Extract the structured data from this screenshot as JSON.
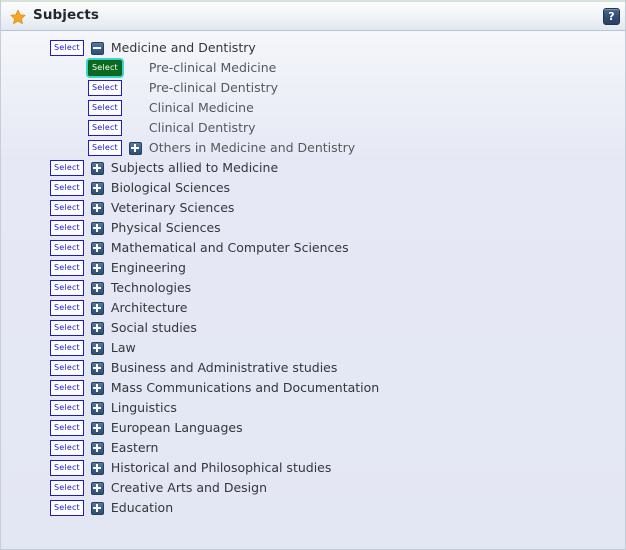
{
  "header": {
    "title": "Subjects",
    "star_icon": "star-icon",
    "help_label": "?",
    "help_icon": "help-question-icon"
  },
  "labels": {
    "select": "Select"
  },
  "colors": {
    "accent_blue": "#2d4f77",
    "select_border": "#1b1bd0",
    "select_text": "#1b1bd0",
    "selected_bg": "#0a6b20",
    "selected_glow": "#3bd4cf",
    "star": "#f2a11f",
    "panel_bg": "#e3e6f3"
  },
  "tree": [
    {
      "label": "Medicine and Dentistry",
      "level": 0,
      "toggle": "minus",
      "selected": false
    },
    {
      "label": "Pre-clinical Medicine",
      "level": 1,
      "toggle": "none",
      "selected": true
    },
    {
      "label": "Pre-clinical Dentistry",
      "level": 1,
      "toggle": "none",
      "selected": false
    },
    {
      "label": "Clinical Medicine",
      "level": 1,
      "toggle": "none",
      "selected": false
    },
    {
      "label": "Clinical Dentistry",
      "level": 1,
      "toggle": "none",
      "selected": false
    },
    {
      "label": "Others in Medicine and Dentistry",
      "level": 1,
      "toggle": "plus",
      "selected": false
    },
    {
      "label": "Subjects allied to Medicine",
      "level": 0,
      "toggle": "plus",
      "selected": false
    },
    {
      "label": "Biological Sciences",
      "level": 0,
      "toggle": "plus",
      "selected": false
    },
    {
      "label": "Veterinary Sciences",
      "level": 0,
      "toggle": "plus",
      "selected": false
    },
    {
      "label": "Physical Sciences",
      "level": 0,
      "toggle": "plus",
      "selected": false
    },
    {
      "label": "Mathematical and Computer Sciences",
      "level": 0,
      "toggle": "plus",
      "selected": false
    },
    {
      "label": "Engineering",
      "level": 0,
      "toggle": "plus",
      "selected": false
    },
    {
      "label": "Technologies",
      "level": 0,
      "toggle": "plus",
      "selected": false
    },
    {
      "label": "Architecture",
      "level": 0,
      "toggle": "plus",
      "selected": false
    },
    {
      "label": "Social studies",
      "level": 0,
      "toggle": "plus",
      "selected": false
    },
    {
      "label": "Law",
      "level": 0,
      "toggle": "plus",
      "selected": false
    },
    {
      "label": "Business and Administrative studies",
      "level": 0,
      "toggle": "plus",
      "selected": false
    },
    {
      "label": "Mass Communications and Documentation",
      "level": 0,
      "toggle": "plus",
      "selected": false
    },
    {
      "label": "Linguistics",
      "level": 0,
      "toggle": "plus",
      "selected": false
    },
    {
      "label": "European Languages",
      "level": 0,
      "toggle": "plus",
      "selected": false
    },
    {
      "label": "Eastern",
      "level": 0,
      "toggle": "plus",
      "selected": false
    },
    {
      "label": "Historical and Philosophical studies",
      "level": 0,
      "toggle": "plus",
      "selected": false
    },
    {
      "label": "Creative Arts and Design",
      "level": 0,
      "toggle": "plus",
      "selected": false
    },
    {
      "label": "Education",
      "level": 0,
      "toggle": "plus",
      "selected": false
    }
  ]
}
